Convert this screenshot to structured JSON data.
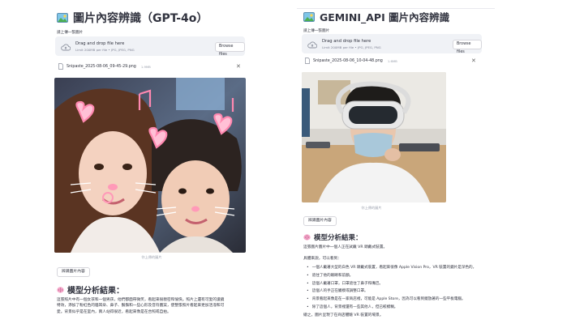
{
  "left": {
    "title": "圖片內容辨識（GPT-4o）",
    "upload_label": "請上傳一張圖片",
    "dropzone": {
      "title": "Drag and drop file here",
      "limit": "Limit 200MB per file • JPG, JPEG, PNG",
      "browse_label": "Browse files"
    },
    "file": {
      "name": "Snipaste_2025-08-06_09-45-29.png",
      "size": "1.9MB"
    },
    "caption": "你上傳的圖片",
    "action_label": "辨識圖片內容",
    "result_title": "模型分析結果：",
    "result_text": [
      "這張照片中有一個女孩和一個男孩，他們都面帶微笑，看起來很親密和愉快。照片上還有可愛的濾鏡",
      "特效，添加了粉紅色的貓耳朵、鼻子、鬍鬚和一些心形及音符圖案，使整張照片看起來更加活潑和可",
      "愛。背景似乎是在室內，兩人站得很近，看起來像是在合照或自拍。"
    ]
  },
  "right": {
    "title": "GEMINI_API 圖片內容辨識",
    "upload_label": "請上傳一張圖片",
    "dropzone": {
      "title": "Drag and drop file here",
      "limit": "Limit 200MB per file • JPG, JPEG, PNG",
      "browse_label": "Browse files"
    },
    "file": {
      "name": "Snipaste_2025-08-06_10-04-48.png",
      "size": "1.6MB"
    },
    "caption": "你上傳的圖片",
    "action_label": "辨識圖片內容",
    "result_title": "模型分析結果：",
    "intro": "這張圖片圖片中一個人正在試戴 VR 頭戴式裝置。",
    "detail_heading": "具體來說，可以看到：",
    "bullets": [
      "一個人戴著大型的白色 VR 頭戴式裝置，看起來很像 Apple Vision Pro，VR 裝置的鏡片是深色的，",
      "遮住了他的眼睛和前額。",
      "這個人戴著口罩，口罩遮住了鼻子和嘴巴。",
      "這個人的手正在觸摸或調整口罩。",
      "背景看起來像是在一家商店裡，可能是 Apple Store，因為可以看到擺放著的一些平板電腦。",
      "除了這個人，背景裡還有一些其他人，但已較模糊。"
    ],
    "conclusion": "總之，圖片呈現了在商店體驗 VR 裝置的場景。"
  },
  "colors": {
    "accent_red": "#ff4b4b",
    "text": "#31333f",
    "dropzone_bg": "#f0f2f6"
  }
}
